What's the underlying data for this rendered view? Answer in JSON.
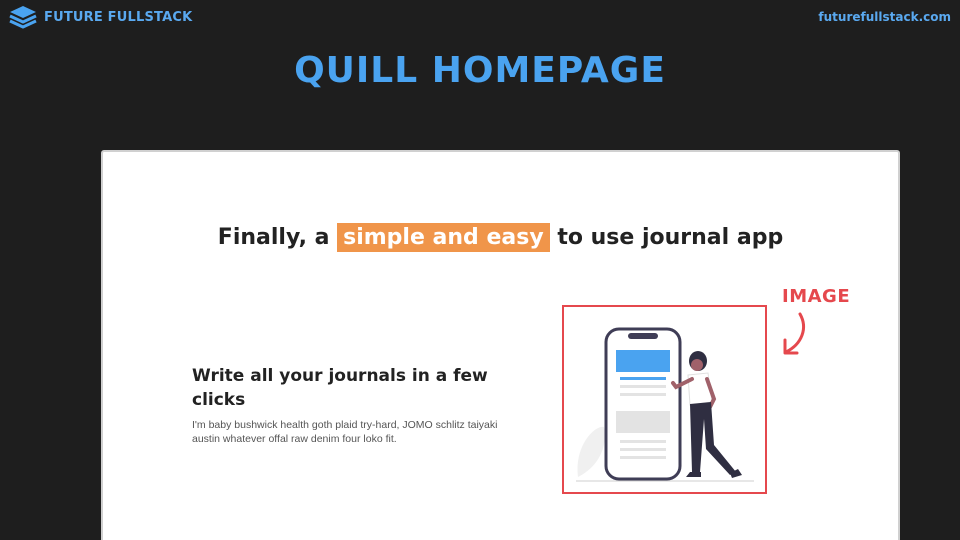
{
  "header": {
    "brand_name": "FUTURE FULLSTACK",
    "brand_icon": "stacked-layers-icon",
    "site_url": "futurefullstack.com"
  },
  "slide": {
    "title": "QUILL HOMEPAGE"
  },
  "mockup": {
    "hero": {
      "headline_before": "Finally, a",
      "headline_highlight": "simple and easy",
      "headline_after": "to use journal app"
    },
    "feature": {
      "title": "Write all your journals in a few clicks",
      "body": "I'm baby bushwick health goth plaid try-hard, JOMO schlitz taiyaki austin whatever offal raw denim four loko fit."
    },
    "illustration": "woman-with-phone-illustration"
  },
  "annotation": {
    "label": "IMAGE",
    "arrow_icon": "curved-arrow-icon"
  },
  "colors": {
    "background": "#1e1e1e",
    "brand_blue": "#4aa3f0",
    "highlight_orange": "#f0954a",
    "annotation_red": "#e5484d"
  }
}
